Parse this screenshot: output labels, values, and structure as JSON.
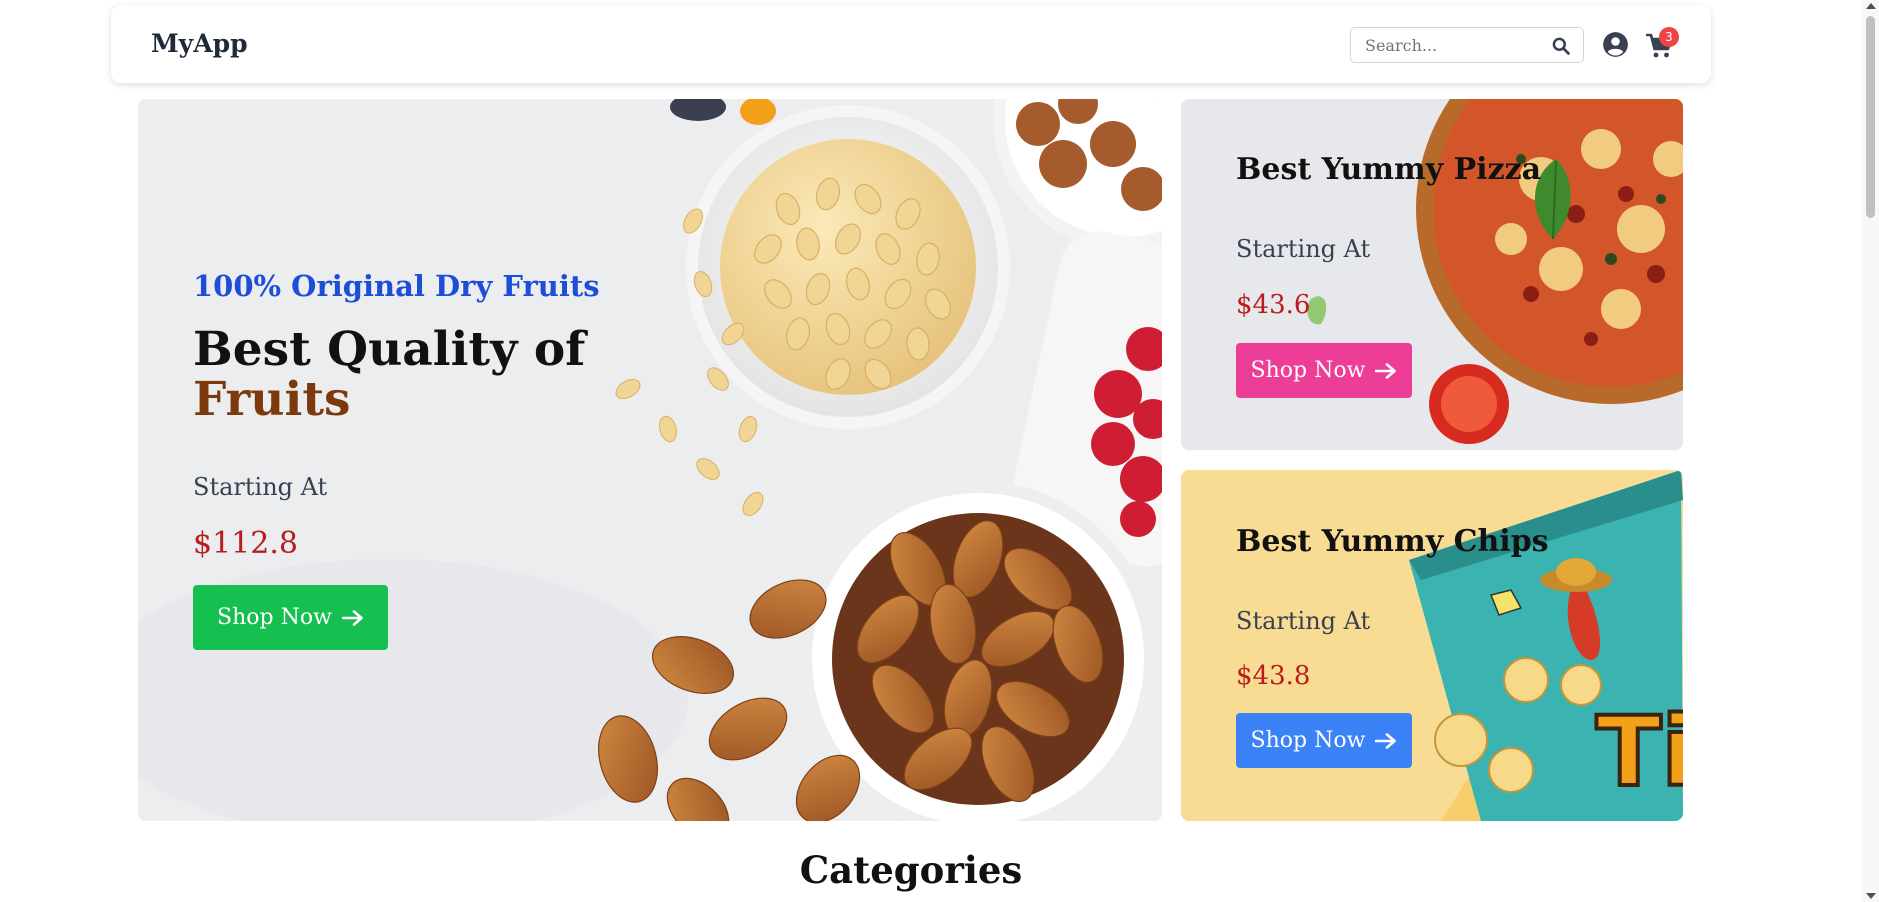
{
  "navbar": {
    "brand": "MyApp",
    "search": {
      "placeholder": "Search..."
    },
    "cart_count": "3",
    "icons": [
      "search-icon",
      "user-circle-icon",
      "cart-icon"
    ]
  },
  "hero": {
    "main": {
      "subtitle": "100% Original Dry Fruits",
      "title_line1": "Best Quality of",
      "title_line2": "Fruits",
      "starting": "Starting At",
      "price": "$112.8",
      "button": "Shop Now",
      "button_color": "#16c050"
    },
    "pizza": {
      "title": "Best Yummy Pizza",
      "starting": "Starting At",
      "price": "$43.6",
      "button": "Shop Now",
      "button_color": "#ec3e97"
    },
    "chips": {
      "title": "Best Yummy Chips",
      "starting": "Starting At",
      "price": "$43.8",
      "button": "Shop Now",
      "button_color": "#3b82f6"
    }
  },
  "categories": {
    "title": "Categories"
  },
  "colors": {
    "price": "#b91c1c",
    "subtitle": "#1d4ed8",
    "accent": "#7c3a0c",
    "badge": "#ef4444"
  }
}
